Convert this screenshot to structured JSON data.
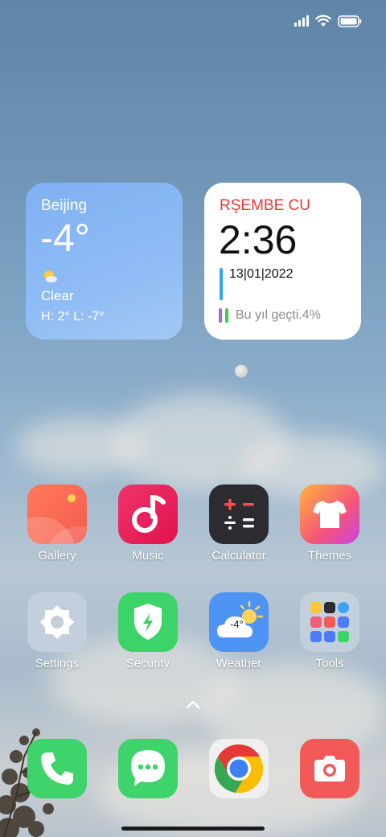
{
  "status": {
    "signal": "signal-icon",
    "wifi": "wifi-icon",
    "battery": "battery-icon"
  },
  "weather_widget": {
    "city": "Beijing",
    "temp": "-4°",
    "condition": "Clear",
    "high_low": "H: 2°  L: -7°",
    "icon": "sun-cloud-icon"
  },
  "clock_widget": {
    "day": "RŞEMBE CU",
    "time": "2:36",
    "date": "13|01|2022",
    "year_progress": "Bu yıl geçti.4%"
  },
  "apps": [
    {
      "label": "Gallery"
    },
    {
      "label": "Music"
    },
    {
      "label": "Calculator"
    },
    {
      "label": "Themes"
    },
    {
      "label": "Settings"
    },
    {
      "label": "Security"
    },
    {
      "label": "Weather",
      "badge": "-4°"
    },
    {
      "label": "Tools"
    }
  ],
  "dock": [
    {
      "name": "Phone"
    },
    {
      "name": "Messaging"
    },
    {
      "name": "Chrome"
    },
    {
      "name": "Camera"
    }
  ],
  "colors": {
    "accent_red": "#e53935",
    "accent_blue": "#2ba6ef",
    "accent_green": "#3ccb4a",
    "accent_purple": "#b05fe0"
  }
}
